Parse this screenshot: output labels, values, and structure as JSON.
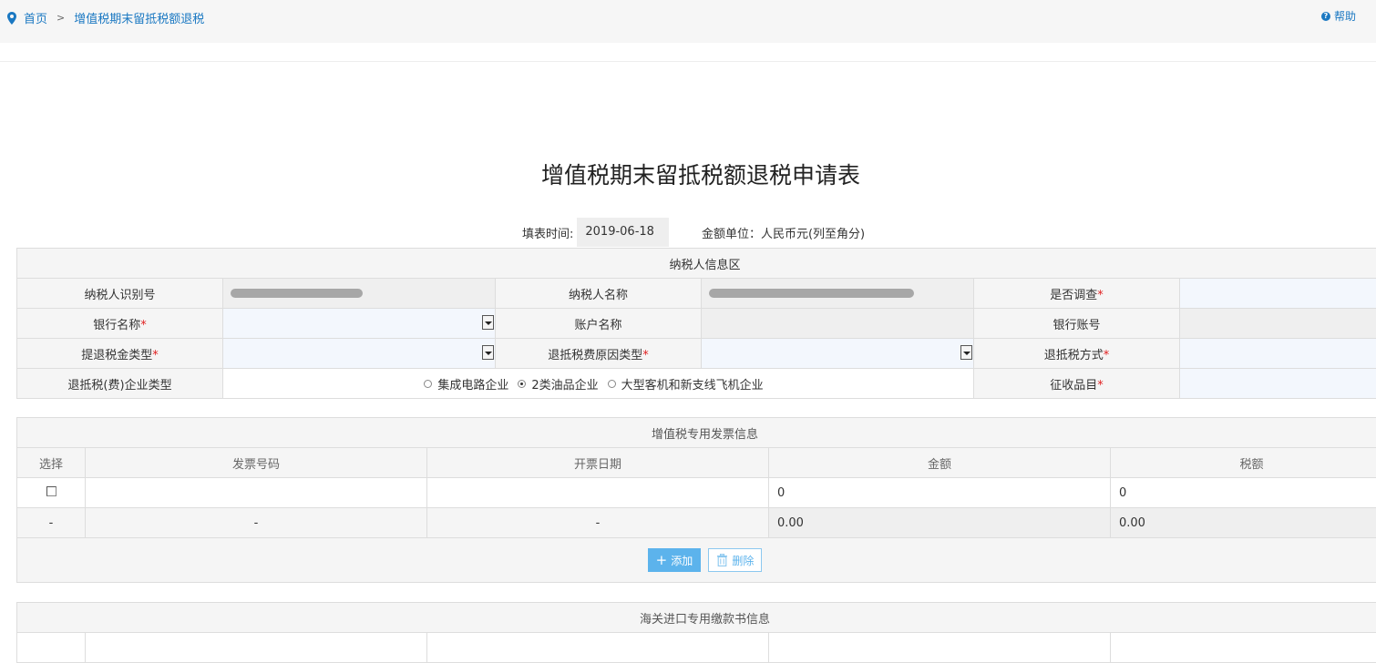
{
  "breadcrumb": {
    "home": "首页",
    "separator": ">",
    "current": "增值税期末留抵税额退税"
  },
  "help_label": "帮助",
  "form_title": "增值税期末留抵税额退税申请表",
  "meta": {
    "date_label": "填表时间:",
    "date_value": "2019-06-18",
    "unit_label": "金额单位：人民币元(列至角分)"
  },
  "taxpayer_section": {
    "header": "纳税人信息区",
    "rows": [
      {
        "l1": "纳税人识别号",
        "l2": "纳税人名称",
        "l3": "是否调查",
        "l3_req": "*"
      },
      {
        "l1": "银行名称",
        "l1_req": "*",
        "l2": "账户名称",
        "l3": "银行账号"
      },
      {
        "l1": "提退税金类型",
        "l1_req": "*",
        "l2": "退抵税费原因类型",
        "l2_req": "*",
        "l3": "退抵税方式",
        "l3_req": "*"
      },
      {
        "l1": "退抵税(费)企业类型",
        "l3": "征收品目",
        "l3_req": "*"
      }
    ],
    "enterprise_types": [
      {
        "label": "集成电路企业",
        "selected": false
      },
      {
        "label": "2类油品企业",
        "selected": true
      },
      {
        "label": "大型客机和新支线飞机企业",
        "selected": false
      }
    ]
  },
  "invoice_section": {
    "header": "增值税专用发票信息",
    "columns": [
      "选择",
      "发票号码",
      "开票日期",
      "金额",
      "税额"
    ],
    "row": {
      "amount": "0",
      "tax": "0"
    },
    "summary": {
      "select": "-",
      "number": "-",
      "date": "-",
      "amount": "0.00",
      "tax": "0.00"
    },
    "add_label": "添加",
    "delete_label": "删除"
  },
  "customs_section": {
    "header": "海关进口专用缴款书信息"
  },
  "colors": {
    "link": "#1a78c2",
    "required": "#e02020",
    "add_button": "#5cb3ec"
  }
}
